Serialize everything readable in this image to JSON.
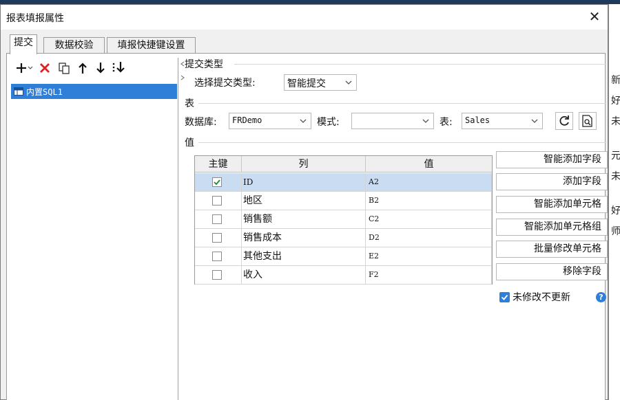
{
  "dialog": {
    "title": "报表填报属性",
    "close_symbol": "✕"
  },
  "tabs": [
    {
      "label": "提交",
      "active": true
    },
    {
      "label": "数据校验",
      "active": false
    },
    {
      "label": "填报快捷键设置",
      "active": false
    }
  ],
  "toolbar": {
    "add": "add-icon",
    "add_dropdown": "dropdown-caret",
    "delete": "delete-icon",
    "copy": "copy-icon",
    "move_up": "arrow-up-icon",
    "move_down": "arrow-down-icon",
    "move_bottom": "move-bottom-icon"
  },
  "tree": {
    "items": [
      {
        "label": "内置SQL1",
        "selected": true
      }
    ]
  },
  "submit_type": {
    "section": "提交类型",
    "label": "选择提交类型:",
    "value": "智能提交"
  },
  "table_section": {
    "section": "表",
    "database_label": "数据库:",
    "database_value": "FRDemo",
    "schema_label": "模式:",
    "schema_value": "",
    "table_label": "表:",
    "table_value": "Sales"
  },
  "values_section": {
    "section": "值",
    "headers": {
      "key": "主键",
      "column": "列",
      "value": "值"
    },
    "rows": [
      {
        "key": true,
        "column": "ID",
        "value": "A2",
        "selected": true
      },
      {
        "key": false,
        "column": "地区",
        "value": "B2",
        "selected": false
      },
      {
        "key": false,
        "column": "销售额",
        "value": "C2",
        "selected": false
      },
      {
        "key": false,
        "column": "销售成本",
        "value": "D2",
        "selected": false
      },
      {
        "key": false,
        "column": "其他支出",
        "value": "E2",
        "selected": false
      },
      {
        "key": false,
        "column": "收入",
        "value": "F2",
        "selected": false
      }
    ]
  },
  "actions": {
    "smart_add_fields": "智能添加字段",
    "add_field": "添加字段",
    "smart_add_cells": "智能添加单元格",
    "smart_add_cell_group": "智能添加单元格组",
    "batch_modify_cells": "批量修改单元格",
    "remove_field": "移除字段"
  },
  "option": {
    "label": "未修改不更新",
    "checked": true,
    "help": "?"
  },
  "background_fragments": [
    "新",
    "好",
    "未",
    "元",
    "未",
    "好",
    "师"
  ],
  "colors": {
    "accent": "#2f7fd9",
    "delete": "#e02020",
    "selection": "#c9dcf2"
  }
}
